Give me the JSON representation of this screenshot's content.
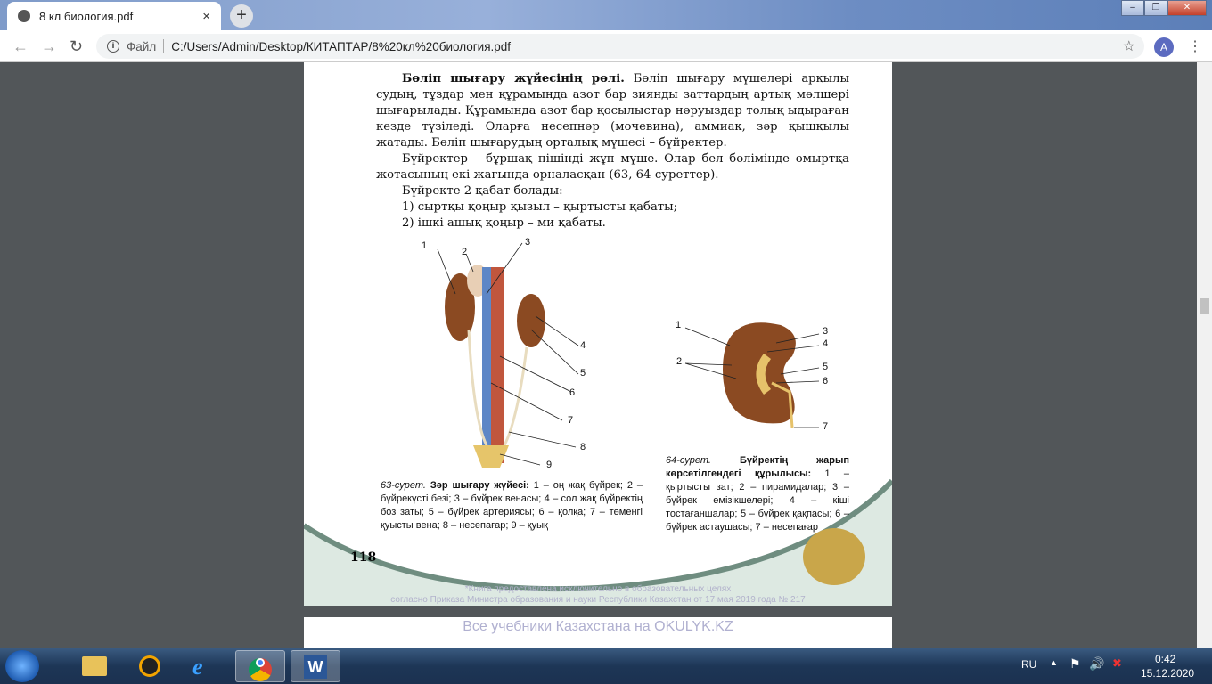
{
  "browser": {
    "tab_title": "8 кл биология.pdf",
    "new_tab": "+",
    "close_tab": "×",
    "address_prefix": "Файл",
    "url": "C:/Users/Admin/Desktop/КИТАПТАР/8%20кл%20биология.pdf",
    "avatar_initial": "A",
    "window_buttons": [
      "–",
      "❐",
      "✕"
    ]
  },
  "page": {
    "heading": "Бөліп шығару жүйесінің рөлі.",
    "paragraphs": [
      "Бөліп шығару мүшелері арқылы судың, тұздар мен құрамында азот бар зиянды заттардың артық мөлшері шығарылады. Құрамында азот бар қосылыстар нәруыздар толық ыдыраған кезде түзіледі. Оларға несепнәр (мочевина), аммиак, зәр қышқылы жатады. Бөліп шығарудың орталық мүшесі – бүйректер.",
      "Бүйректер – бұршақ пішінді жұп мүше. Олар бел бөлімінде омыртқа жотасының екі жағында орналасқан (63, 64-суреттер).",
      "Бүйректе 2 қабат болады:",
      "1) сыртқы қоңыр қызыл – қыртысты қабаты;",
      "2) ішкі ашық қоңыр – ми қабаты."
    ],
    "fig63": {
      "labels": [
        "1",
        "2",
        "3",
        "4",
        "5",
        "6",
        "7",
        "8",
        "9"
      ],
      "caption_num": "63-сурет.",
      "caption_title": "Зәр шығару жүйесі:",
      "caption_text": "1 – оң жақ бүйрек; 2 – бүйрекүсті безі; 3 – бүйрек венасы; 4 – сол жақ бүйректің боз заты; 5 – бүйрек артериясы; 6 – қолқа; 7 – төменгі қуысты вена; 8 – несепағар; 9 – қуық"
    },
    "fig64": {
      "labels": [
        "1",
        "2",
        "3",
        "4",
        "5",
        "6",
        "7"
      ],
      "caption_num": "64-сурет.",
      "caption_title": "Бүйректің жарып көрсетілгендегі құрылысы:",
      "caption_text": "1 – қыртысты зат; 2 – пирамидалар; 3 – бүйрек емізікшелері; 4 – кіші тостағаншалар; 5 – бүйрек қақпасы; 6 – бүйрек астаушасы; 7 – несепағар"
    },
    "page_number": "118",
    "watermark_1": "*Книга предоставлена исключительно в образовательных целях",
    "watermark_2": "согласно Приказа Министра образования и науки Республики Казахстан от 17 мая 2019 года № 217",
    "next_page_watermark": "Все учебники Казахстана на OKULYK.KZ"
  },
  "taskbar": {
    "language": "RU",
    "time": "0:42",
    "date": "15.12.2020",
    "apps": [
      "file-explorer",
      "media-player",
      "internet-explorer",
      "chrome",
      "word"
    ]
  }
}
